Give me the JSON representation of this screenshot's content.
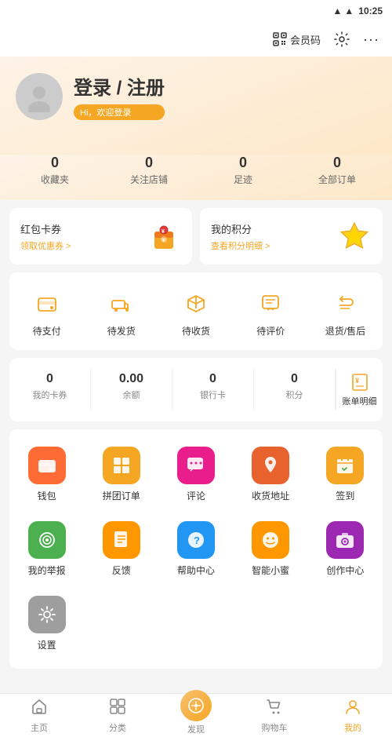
{
  "statusBar": {
    "time": "10:25",
    "wifiIcon": "▲▲",
    "batteryIcon": "🔋"
  },
  "header": {
    "memberCode": "会员码",
    "settingsIcon": "⚙",
    "moreIcon": "···"
  },
  "profile": {
    "loginTitle": "登录 / 注册",
    "welcomeText": "Hi，欢迎登录"
  },
  "stats": [
    {
      "num": "0",
      "label": "收藏夹"
    },
    {
      "num": "0",
      "label": "关注店铺"
    },
    {
      "num": "0",
      "label": "足迹"
    },
    {
      "num": "0",
      "label": "全部订单"
    }
  ],
  "cards": [
    {
      "title": "红包卡券",
      "link": "领取优惠券 >"
    },
    {
      "title": "我的积分",
      "link": "查看积分明细 >"
    }
  ],
  "orderSection": {
    "icons": [
      {
        "label": "待支付"
      },
      {
        "label": "待发货"
      },
      {
        "label": "待收货"
      },
      {
        "label": "待评价"
      },
      {
        "label": "退货/售后"
      }
    ]
  },
  "balance": {
    "items": [
      {
        "num": "0",
        "label": "我的卡券"
      },
      {
        "num": "0.00",
        "label": "余额"
      },
      {
        "num": "0",
        "label": "银行卡"
      },
      {
        "num": "0",
        "label": "积分"
      }
    ],
    "billLabel": "账单明细"
  },
  "features": [
    {
      "label": "钱包",
      "bg": "#FF6B35",
      "emoji": "👛"
    },
    {
      "label": "拼团订单",
      "bg": "#F5A623",
      "emoji": "🀄"
    },
    {
      "label": "评论",
      "bg": "#E91E8C",
      "emoji": "💬"
    },
    {
      "label": "收货地址",
      "bg": "#E8622E",
      "emoji": "📍"
    },
    {
      "label": "签到",
      "bg": "#F5A623",
      "emoji": "📅"
    },
    {
      "label": "我的举报",
      "bg": "#4CAF50",
      "emoji": "🎯"
    },
    {
      "label": "反馈",
      "bg": "#FF9800",
      "emoji": "📋"
    },
    {
      "label": "帮助中心",
      "bg": "#2196F3",
      "emoji": "❓"
    },
    {
      "label": "智能小蜜",
      "bg": "#FF9800",
      "emoji": "😊"
    },
    {
      "label": "创作中心",
      "bg": "#9C27B0",
      "emoji": "📷"
    },
    {
      "label": "设置",
      "bg": "#9E9E9E",
      "emoji": "⚙"
    }
  ],
  "bottomNav": [
    {
      "label": "主页",
      "icon": "⌂",
      "active": false
    },
    {
      "label": "分类",
      "icon": "⊞",
      "active": false
    },
    {
      "label": "发现",
      "icon": "◎",
      "active": false,
      "special": true
    },
    {
      "label": "购物车",
      "icon": "🛒",
      "active": false
    },
    {
      "label": "我的",
      "icon": "👤",
      "active": true
    }
  ]
}
